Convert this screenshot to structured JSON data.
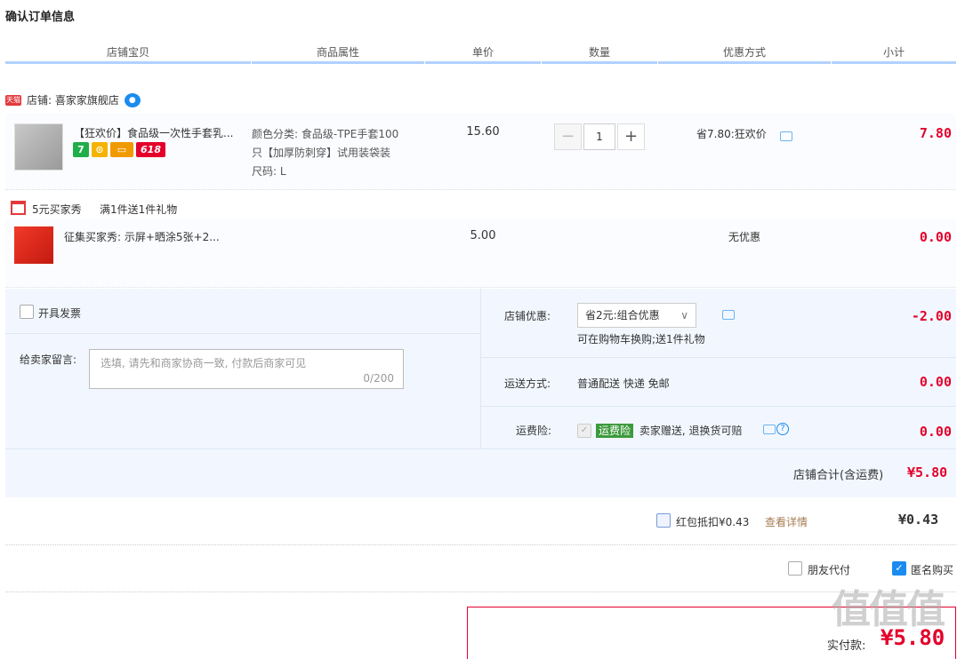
{
  "page_title": "确认订单信息",
  "columns": [
    "店铺宝贝",
    "商品属性",
    "单价",
    "数量",
    "优惠方式",
    "小计"
  ],
  "shop": {
    "label": "店铺: 喜家家旗舰店",
    "badge": "天猫"
  },
  "items": [
    {
      "name": "【狂欢价】食品级一次性手套乳...",
      "attr_line1": "颜色分类: 食品级-TPE手套100",
      "attr_line2": "只【加厚防刺穿】试用装袋装",
      "attr_line3": "尺码: L",
      "unit_price": "15.60",
      "quantity": "1",
      "discount": "省7.80:狂欢价",
      "subtotal": "7.80",
      "badges": [
        "7",
        "618"
      ]
    },
    {
      "name": "征集买家秀: 示屏+晒涂5张+2...",
      "unit_price": "5.00",
      "discount": "无优惠",
      "subtotal": "0.00"
    }
  ],
  "gift": {
    "label": "5元买家秀",
    "rule": "满1件送1件礼物"
  },
  "invoice_label": "开具发票",
  "message": {
    "label": "给卖家留言:",
    "placeholder": "选填, 请先和商家协商一致, 付款后商家可见",
    "counter": "0/200"
  },
  "shop_discount": {
    "label": "店铺优惠:",
    "selected": "省2元:组合优惠",
    "note": "可在购物车换购;送1件礼物",
    "amount": "-2.00"
  },
  "shipping": {
    "label": "运送方式:",
    "value": "普通配送 快递 免邮",
    "amount": "0.00"
  },
  "insurance": {
    "label": "运费险:",
    "tag": "运费险",
    "text": "卖家赠送, 退换货可赔",
    "amount": "0.00"
  },
  "shop_total": {
    "label": "店铺合计(含运费)",
    "amount": "¥5.80"
  },
  "red_packet": {
    "label": "红包抵扣¥0.43",
    "link": "查看详情",
    "amount": "¥0.43"
  },
  "friend_pay": "朋友代付",
  "anonymous": "匿名购买",
  "final": {
    "label": "实付款:",
    "amount": "¥5.80"
  },
  "watermark": "值值值"
}
